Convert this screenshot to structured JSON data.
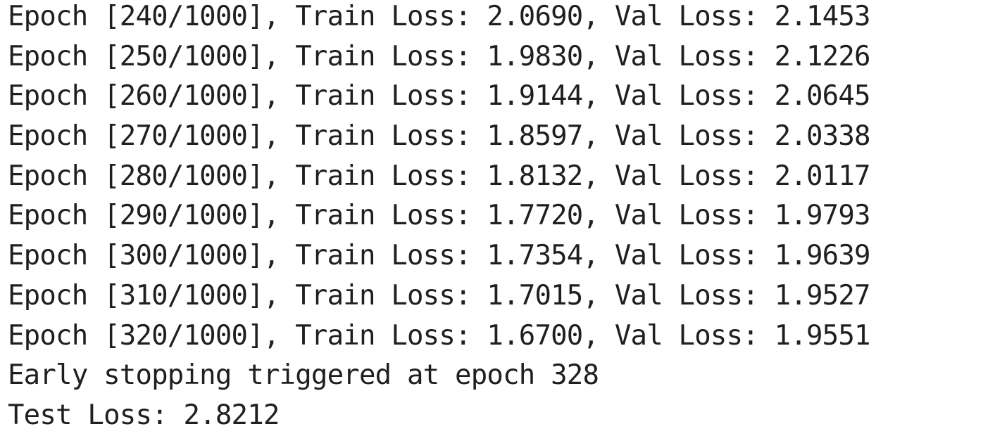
{
  "output": {
    "lines": [
      "Epoch [240/1000], Train Loss: 2.0690, Val Loss: 2.1453",
      "Epoch [250/1000], Train Loss: 1.9830, Val Loss: 2.1226",
      "Epoch [260/1000], Train Loss: 1.9144, Val Loss: 2.0645",
      "Epoch [270/1000], Train Loss: 1.8597, Val Loss: 2.0338",
      "Epoch [280/1000], Train Loss: 1.8132, Val Loss: 2.0117",
      "Epoch [290/1000], Train Loss: 1.7720, Val Loss: 1.9793",
      "Epoch [300/1000], Train Loss: 1.7354, Val Loss: 1.9639",
      "Epoch [310/1000], Train Loss: 1.7015, Val Loss: 1.9527",
      "Epoch [320/1000], Train Loss: 1.6700, Val Loss: 1.9551",
      "Early stopping triggered at epoch 328",
      "Test Loss: 2.8212"
    ]
  }
}
